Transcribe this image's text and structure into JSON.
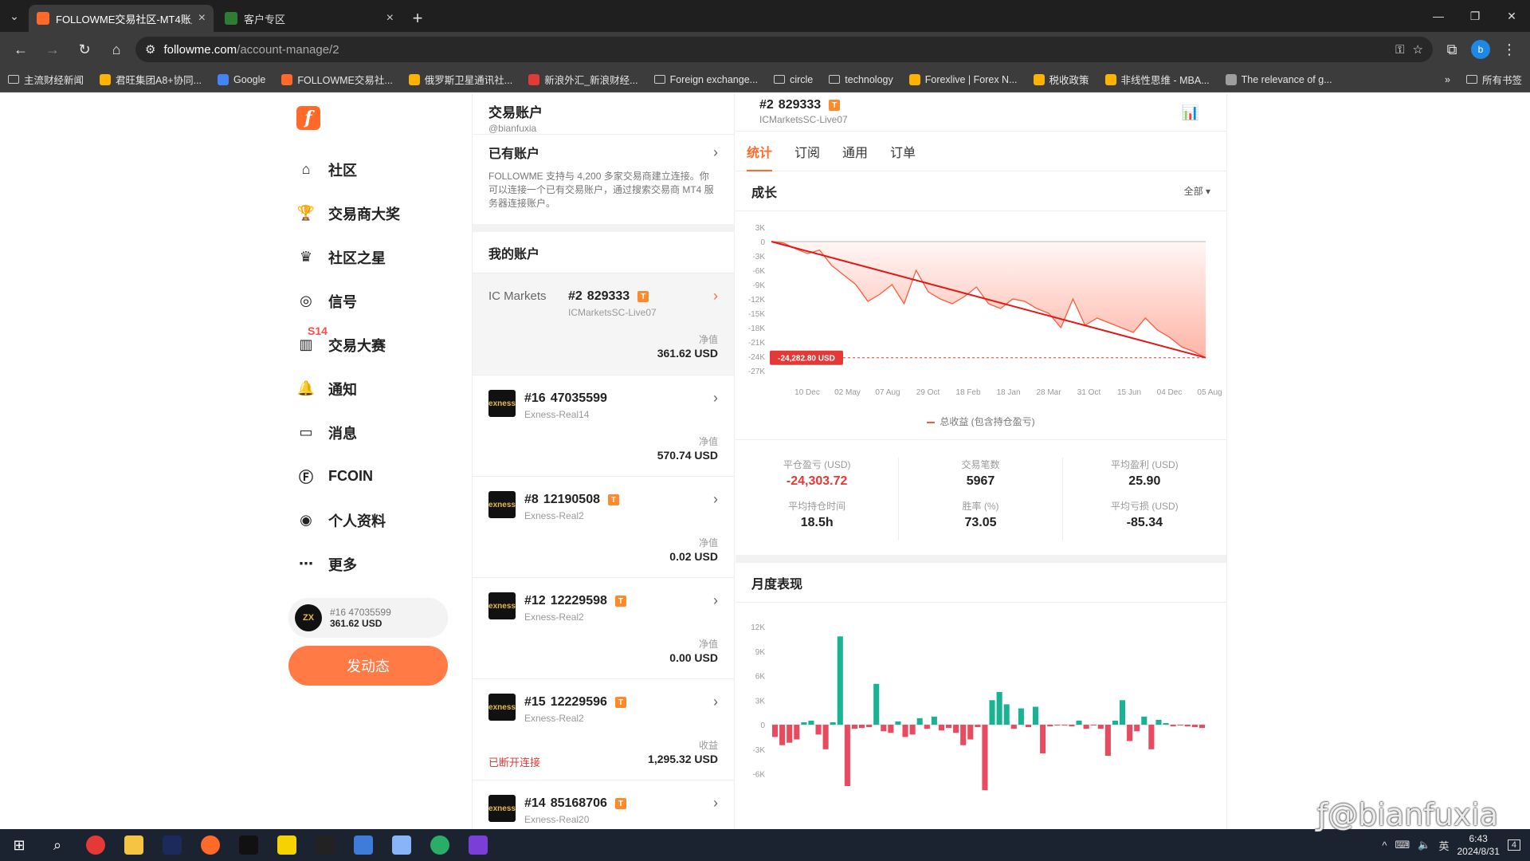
{
  "browser": {
    "tabs": [
      {
        "title": "FOLLOWME交易社区-MT4账户",
        "active": true,
        "favicon_color": "#ff6a2b"
      },
      {
        "title": "客户专区",
        "active": false,
        "favicon_color": "#2e7d32"
      }
    ],
    "url_host": "followme.com",
    "url_path": "/account-manage/2",
    "profile_letter": "b",
    "bookmarks": [
      {
        "label": "主流财经新闻",
        "icon": "folder-icon"
      },
      {
        "label": "君旺集团A8+协同...",
        "icon": "site-icon"
      },
      {
        "label": "Google",
        "icon": "google-icon"
      },
      {
        "label": "FOLLOWME交易社...",
        "icon": "followme-icon"
      },
      {
        "label": "俄罗斯卫星通讯社...",
        "icon": "site-icon"
      },
      {
        "label": "新浪外汇_新浪财经...",
        "icon": "sina-icon"
      },
      {
        "label": "Foreign exchange...",
        "icon": "folder-icon"
      },
      {
        "label": "circle",
        "icon": "folder-icon"
      },
      {
        "label": "technology",
        "icon": "folder-icon"
      },
      {
        "label": "Forexlive | Forex N...",
        "icon": "site-icon"
      },
      {
        "label": "税收政策",
        "icon": "site-icon"
      },
      {
        "label": "非线性思维 - MBA...",
        "icon": "site-icon"
      },
      {
        "label": "The relevance of g...",
        "icon": "globe-icon"
      }
    ],
    "all_bookmarks": "所有书签"
  },
  "sidebar": {
    "logo": "f",
    "items": [
      {
        "label": "社区",
        "icon": "home-icon"
      },
      {
        "label": "交易商大奖",
        "icon": "trophy-icon"
      },
      {
        "label": "社区之星",
        "icon": "crown-icon"
      },
      {
        "label": "信号",
        "icon": "signal-icon"
      },
      {
        "label": "交易大赛",
        "icon": "chart-icon",
        "badge": "S14"
      },
      {
        "label": "通知",
        "icon": "bell-icon"
      },
      {
        "label": "消息",
        "icon": "message-icon"
      },
      {
        "label": "FCOIN",
        "icon": "coin-icon"
      },
      {
        "label": "个人资料",
        "icon": "user-icon"
      },
      {
        "label": "更多",
        "icon": "more-icon"
      }
    ],
    "mini_account": {
      "line1": "#16   47035599",
      "line2": "361.62 USD",
      "avatar": "ZX"
    },
    "post_button": "发动态"
  },
  "accounts": {
    "title": "交易账户",
    "username": "@bianfuxia",
    "existing_label": "已有账户",
    "description": "FOLLOWME 支持与 4,200 多家交易商建立连接。你可以连接一个已有交易账户，通过搜索交易商 MT4 服务器连接账户。",
    "my_accounts_label": "我的账户",
    "list": [
      {
        "num": "#2",
        "id": "829333",
        "badge": "T",
        "server": "ICMarketsSC-Live07",
        "value_label": "净值",
        "value": "361.62 USD",
        "broker": "IC Markets",
        "selected": true
      },
      {
        "num": "#16",
        "id": "47035599",
        "badge": "",
        "server": "Exness-Real14",
        "value_label": "净值",
        "value": "570.74 USD",
        "broker": "exness"
      },
      {
        "num": "#8",
        "id": "12190508",
        "badge": "T",
        "server": "Exness-Real2",
        "value_label": "净值",
        "value": "0.02 USD",
        "broker": "exness"
      },
      {
        "num": "#12",
        "id": "12229598",
        "badge": "T",
        "server": "Exness-Real2",
        "value_label": "净值",
        "value": "0.00 USD",
        "broker": "exness"
      },
      {
        "num": "#15",
        "id": "12229596",
        "badge": "T",
        "server": "Exness-Real2",
        "value_label": "收益",
        "value": "1,295.32 USD",
        "broker": "exness",
        "status": "已断开连接"
      },
      {
        "num": "#14",
        "id": "85168706",
        "badge": "T",
        "server": "Exness-Real20",
        "value_label": "",
        "value": "",
        "broker": "exness"
      }
    ]
  },
  "detail": {
    "title_num": "#2",
    "title_id": "829333",
    "badge": "T",
    "server": "ICMarketsSC-Live07",
    "tabs": [
      "统计",
      "订阅",
      "通用",
      "订单"
    ],
    "growth_title": "成长",
    "range_dropdown": "全部 ▾",
    "legend": "总收益 (包含持仓盈亏)",
    "monthly_title": "月度表现",
    "stats": [
      {
        "label": "平仓盈亏 (USD)",
        "value": "-24,303.72",
        "negative": true
      },
      {
        "label": "交易笔数",
        "value": "5967"
      },
      {
        "label": "平均盈利 (USD)",
        "value": "25.90"
      },
      {
        "label": "平均持仓时间",
        "value": "18.5h"
      },
      {
        "label": "胜率 (%)",
        "value": "73.05"
      },
      {
        "label": "平均亏损 (USD)",
        "value": "-85.34"
      }
    ]
  },
  "chart_data": [
    {
      "type": "area",
      "title": "成长",
      "series": [
        {
          "name": "总收益 (包含持仓盈亏)",
          "color": "#ff5a3a"
        }
      ],
      "x_ticks": [
        "10 Dec",
        "02 May",
        "07 Aug",
        "29 Oct",
        "18 Feb",
        "18 Jan",
        "28 Mar",
        "31 Oct",
        "15 Jun",
        "04 Dec",
        "05 Aug"
      ],
      "y_ticks": [
        "3K",
        "0",
        "-3K",
        "-6K",
        "-9K",
        "-12K",
        "-15K",
        "-18K",
        "-21K",
        "-24K",
        "-27K"
      ],
      "ylim": [
        -27000,
        3000
      ],
      "values": [
        0,
        -300,
        -1500,
        -2500,
        -1800,
        -5000,
        -7000,
        -9000,
        -12500,
        -11000,
        -9000,
        -13000,
        -6000,
        -10500,
        -12000,
        -13000,
        -11500,
        -9500,
        -13000,
        -14000,
        -12000,
        -12500,
        -14000,
        -15000,
        -18000,
        -12000,
        -17500,
        -16000,
        -17000,
        -18000,
        -19000,
        -16000,
        -18500,
        -20000,
        -22000,
        -23000,
        -24282.8
      ],
      "last_value_label": "-24,282.80 USD",
      "trendline": [
        0,
        -24282.8
      ]
    },
    {
      "type": "bar",
      "title": "月度表现",
      "y_ticks": [
        "12K",
        "9K",
        "6K",
        "3K",
        "0",
        "-3K",
        "-6K"
      ],
      "ylim": [
        -7500,
        12000
      ],
      "positive_color": "#19b394",
      "negative_color": "#e84a5f",
      "values": [
        -1500,
        -2500,
        -2200,
        -1800,
        300,
        500,
        -1200,
        -3000,
        300,
        10800,
        -7500,
        -500,
        -400,
        -300,
        5000,
        -800,
        -1000,
        400,
        -1500,
        -1200,
        800,
        -500,
        1000,
        -700,
        -400,
        -1000,
        -2500,
        -1800,
        -300,
        -8000,
        3000,
        4000,
        2500,
        -500,
        2000,
        -300,
        2200,
        -3500,
        -200,
        -100,
        -100,
        -200,
        500,
        -500,
        -100,
        -500,
        -3800,
        500,
        3000,
        -2000,
        -800,
        1000,
        -3000,
        600,
        200,
        -200,
        -100,
        -200,
        -300,
        -400
      ]
    }
  ],
  "taskbar": {
    "time": "6:43",
    "date": "2024/8/31",
    "ime": "英",
    "notifications": "4"
  },
  "watermark": "ƒ@bianfuxia"
}
